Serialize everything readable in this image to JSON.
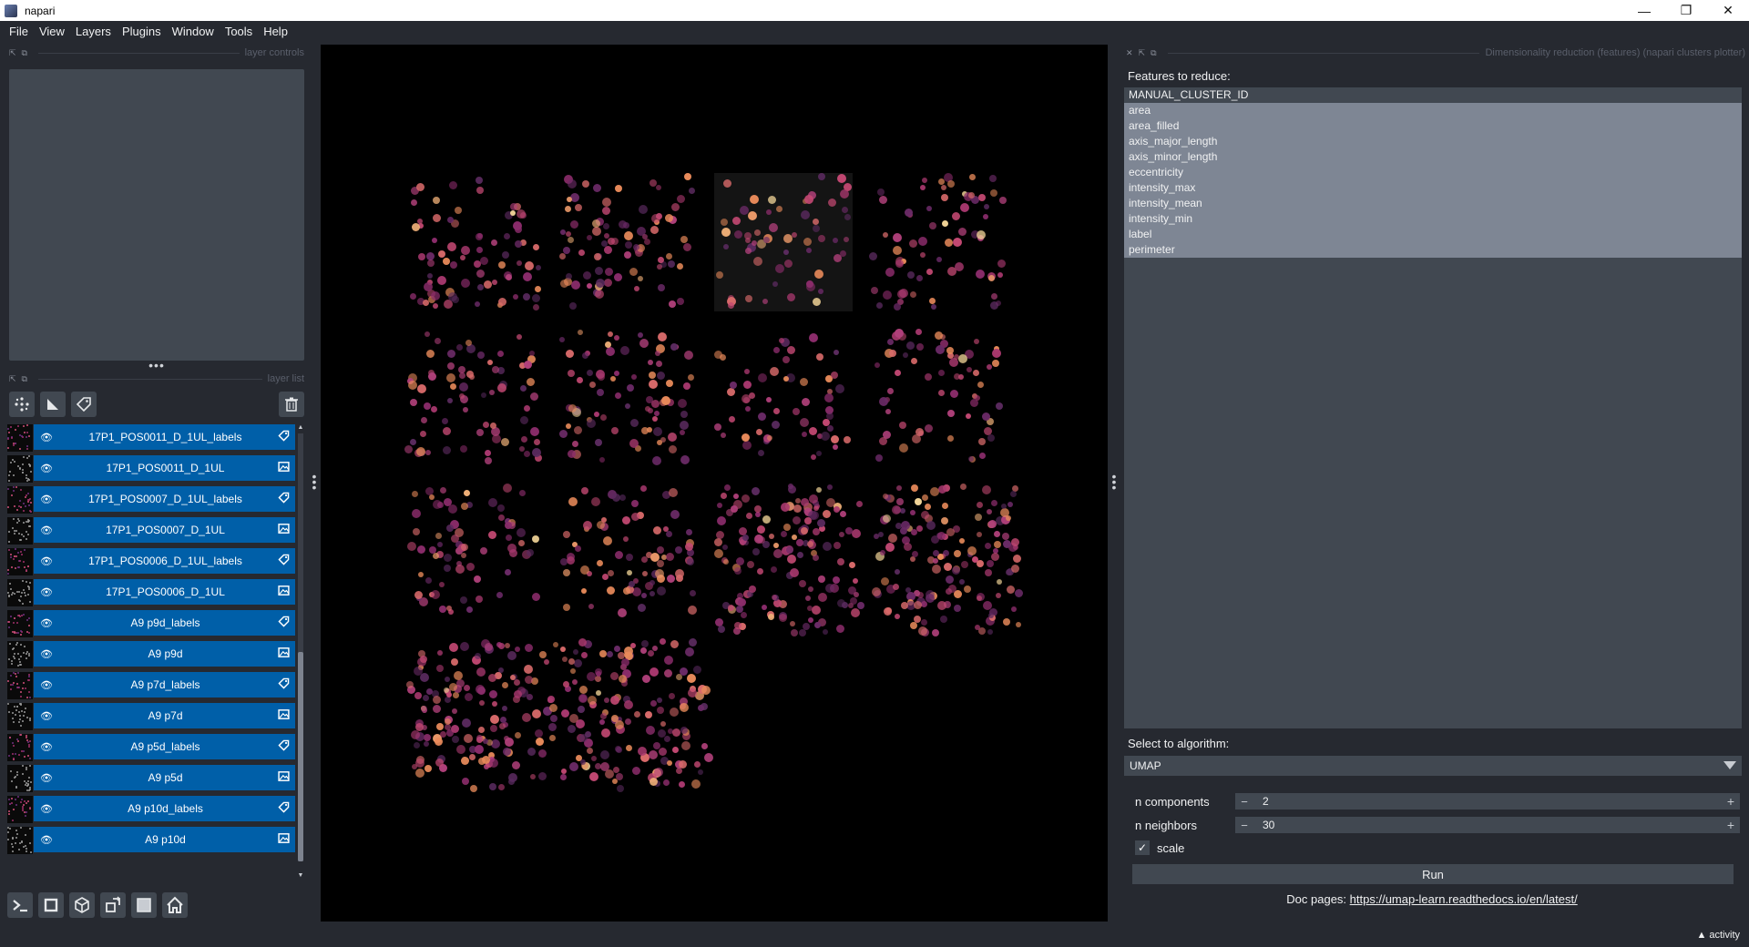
{
  "window": {
    "title": "napari",
    "min": "—",
    "max": "❐",
    "close": "✕"
  },
  "menu": [
    "File",
    "View",
    "Layers",
    "Plugins",
    "Window",
    "Tools",
    "Help"
  ],
  "docks": {
    "layer_controls": "layer controls",
    "layer_list": "layer list",
    "plugin": "Dimensionality reduction (features) (napari clusters plotter)"
  },
  "layers": [
    {
      "name": "17P1_POS0011_D_1UL_labels",
      "type": "labels"
    },
    {
      "name": "17P1_POS0011_D_1UL",
      "type": "image"
    },
    {
      "name": "17P1_POS0007_D_1UL_labels",
      "type": "labels"
    },
    {
      "name": "17P1_POS0007_D_1UL",
      "type": "image"
    },
    {
      "name": "17P1_POS0006_D_1UL_labels",
      "type": "labels"
    },
    {
      "name": "17P1_POS0006_D_1UL",
      "type": "image"
    },
    {
      "name": "A9 p9d_labels",
      "type": "labels"
    },
    {
      "name": "A9 p9d",
      "type": "image"
    },
    {
      "name": "A9 p7d_labels",
      "type": "labels"
    },
    {
      "name": "A9 p7d",
      "type": "image"
    },
    {
      "name": "A9 p5d_labels",
      "type": "labels"
    },
    {
      "name": "A9 p5d",
      "type": "image"
    },
    {
      "name": "A9 p10d_labels",
      "type": "labels"
    },
    {
      "name": "A9 p10d",
      "type": "image"
    }
  ],
  "plugin": {
    "features_label": "Features to reduce:",
    "features": [
      {
        "name": "MANUAL_CLUSTER_ID",
        "selected": false
      },
      {
        "name": "area",
        "selected": true
      },
      {
        "name": "area_filled",
        "selected": true
      },
      {
        "name": "axis_major_length",
        "selected": true
      },
      {
        "name": "axis_minor_length",
        "selected": true
      },
      {
        "name": "eccentricity",
        "selected": true
      },
      {
        "name": "intensity_max",
        "selected": true
      },
      {
        "name": "intensity_mean",
        "selected": true
      },
      {
        "name": "intensity_min",
        "selected": true
      },
      {
        "name": "label",
        "selected": true
      },
      {
        "name": "perimeter",
        "selected": true
      }
    ],
    "algorithm_label": "Select to algorithm:",
    "algorithm": "UMAP",
    "n_components_label": "n components",
    "n_components": "2",
    "n_neighbors_label": "n neighbors",
    "n_neighbors": "30",
    "scale_label": "scale",
    "scale_checked": true,
    "run_label": "Run",
    "doc_prefix": "Doc pages:",
    "doc_link": "https://umap-learn.readthedocs.io/en/latest/"
  },
  "status": {
    "activity": "▲ activity"
  },
  "colors": {
    "accent": "#005fa8",
    "panel": "#414851",
    "background": "#262930"
  }
}
